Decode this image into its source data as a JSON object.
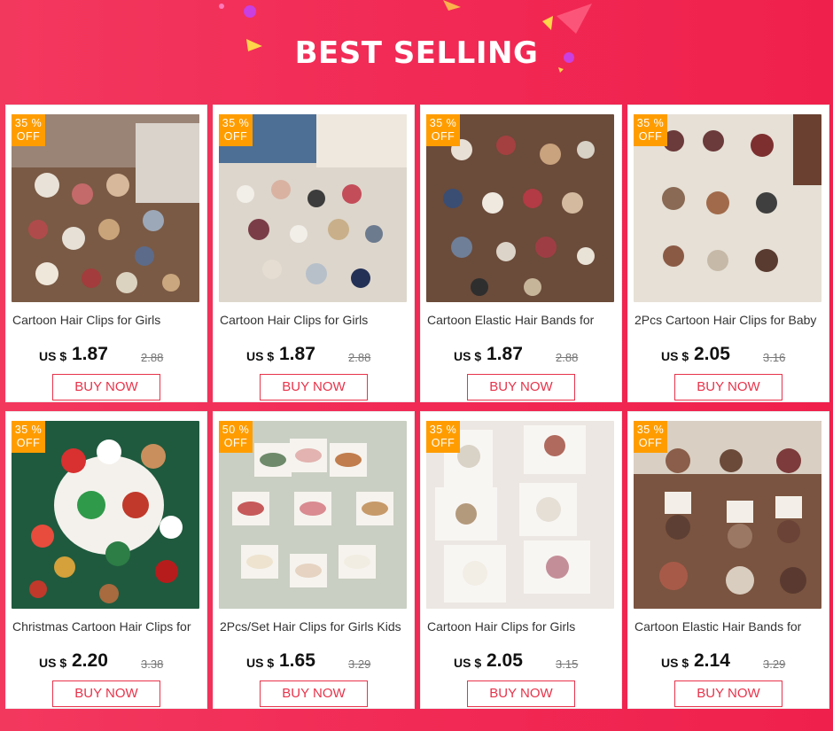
{
  "header": {
    "title": "BEST SELLING"
  },
  "products": [
    {
      "name": "Cartoon Hair Clips for Girls",
      "discount": "35 %",
      "off": "OFF",
      "currency": "US $",
      "price": "1.87",
      "original_price": "2.88",
      "buy_label": "BUY NOW",
      "theme": "brown-plush"
    },
    {
      "name": "Cartoon Hair Clips for Girls",
      "discount": "35 %",
      "off": "OFF",
      "currency": "US $",
      "price": "1.87",
      "original_price": "2.88",
      "buy_label": "BUY NOW",
      "theme": "white-plush"
    },
    {
      "name": "Cartoon Elastic Hair Bands for",
      "discount": "35 %",
      "off": "OFF",
      "currency": "US $",
      "price": "1.87",
      "original_price": "2.88",
      "buy_label": "BUY NOW",
      "theme": "brown-plush-2"
    },
    {
      "name": "2Pcs Cartoon Hair Clips for Baby",
      "discount": "35 %",
      "off": "OFF",
      "currency": "US $",
      "price": "2.05",
      "original_price": "3.16",
      "buy_label": "BUY NOW",
      "theme": "grey-flowers"
    },
    {
      "name": "Christmas Cartoon Hair Clips for",
      "discount": "35 %",
      "off": "OFF",
      "currency": "US $",
      "price": "2.20",
      "original_price": "3.38",
      "buy_label": "BUY NOW",
      "theme": "christmas"
    },
    {
      "name": "2Pcs/Set Hair Clips for Girls Kids",
      "discount": "50 %",
      "off": "OFF",
      "currency": "US $",
      "price": "1.65",
      "original_price": "3.29",
      "buy_label": "BUY NOW",
      "theme": "bows"
    },
    {
      "name": "Cartoon Hair Clips for Girls",
      "discount": "35 %",
      "off": "OFF",
      "currency": "US $",
      "price": "2.05",
      "original_price": "3.15",
      "buy_label": "BUY NOW",
      "theme": "cards"
    },
    {
      "name": "Cartoon Elastic Hair Bands for",
      "discount": "35 %",
      "off": "OFF",
      "currency": "US $",
      "price": "2.14",
      "original_price": "3.29",
      "buy_label": "BUY NOW",
      "theme": "brown-bands"
    }
  ],
  "colors": {
    "background": "#f12a55",
    "badge": "#ff9d00",
    "button_border": "#e8334a"
  }
}
